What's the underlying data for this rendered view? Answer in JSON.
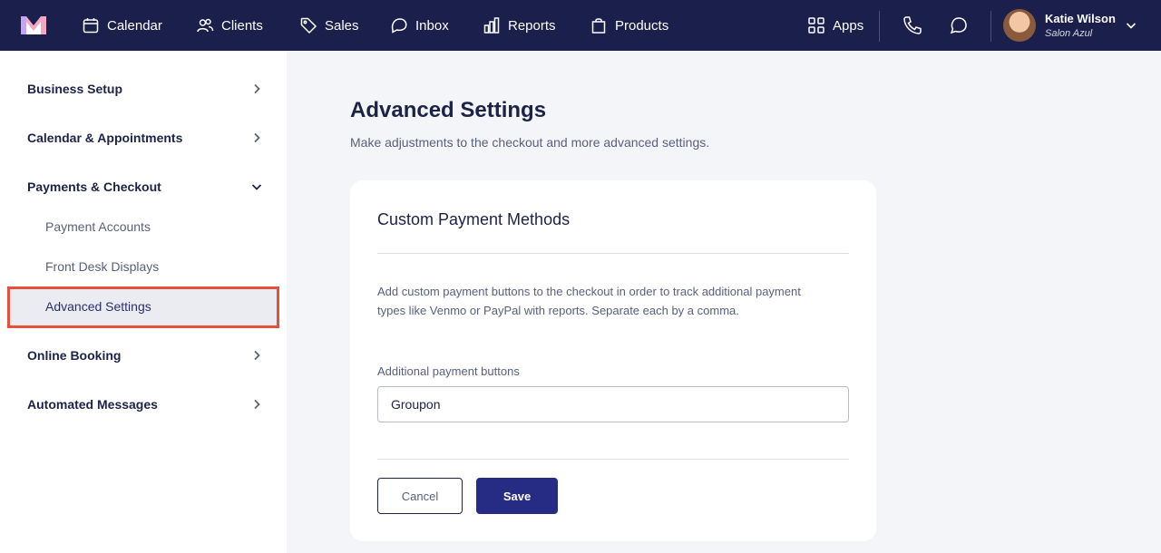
{
  "colors": {
    "topbar": "#1b1f4c",
    "accent": "#262b84",
    "highlight_border": "#e4503c"
  },
  "nav": {
    "items": [
      {
        "label": "Calendar",
        "icon": "calendar-icon"
      },
      {
        "label": "Clients",
        "icon": "users-icon"
      },
      {
        "label": "Sales",
        "icon": "tag-icon"
      },
      {
        "label": "Inbox",
        "icon": "inbox-icon"
      },
      {
        "label": "Reports",
        "icon": "bar-chart-icon"
      },
      {
        "label": "Products",
        "icon": "shopping-bag-icon"
      }
    ],
    "apps_label": "Apps"
  },
  "user": {
    "name": "Katie Wilson",
    "salon": "Salon Azul"
  },
  "sidebar": {
    "items": [
      {
        "label": "Business Setup",
        "icon": "chevron-right-icon"
      },
      {
        "label": "Calendar & Appointments",
        "icon": "chevron-right-icon"
      },
      {
        "label": "Payments & Checkout",
        "icon": "chevron-down-icon"
      },
      {
        "label": "Online Booking",
        "icon": "chevron-right-icon"
      },
      {
        "label": "Automated Messages",
        "icon": "chevron-right-icon"
      }
    ],
    "subitems": [
      "Payment Accounts",
      "Front Desk Displays",
      "Advanced Settings"
    ]
  },
  "main": {
    "title": "Advanced Settings",
    "subtitle": "Make adjustments to the checkout and more advanced settings.",
    "card": {
      "title": "Custom Payment Methods",
      "description": "Add custom payment buttons to the checkout in order to track additional payment types like Venmo or PayPal with reports. Separate each by a comma.",
      "field_label": "Additional payment buttons",
      "field_value": "Groupon",
      "cancel_label": "Cancel",
      "save_label": "Save"
    }
  }
}
